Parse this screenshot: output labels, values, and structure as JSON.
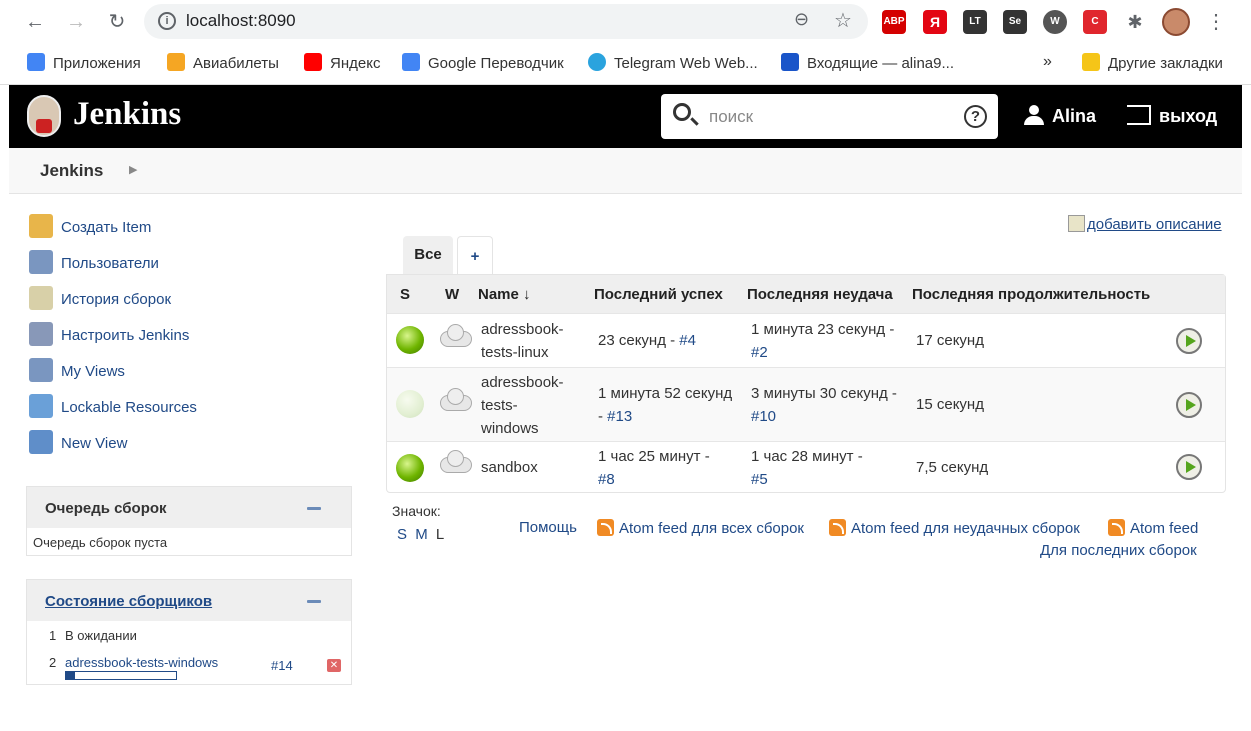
{
  "browser": {
    "url": "localhost:8090",
    "bookmarks": [
      {
        "label": "Приложения",
        "color": "#4285f4"
      },
      {
        "label": "Авиабилеты",
        "color": "#f5a623"
      },
      {
        "label": "Яндекс",
        "color": "#ff0000"
      },
      {
        "label": "Google Переводчик",
        "color": "#4285f4"
      },
      {
        "label": "Telegram Web Web...",
        "color": "#2aa3de"
      },
      {
        "label": "Входящие — alina9...",
        "color": "#1a55c9"
      }
    ],
    "more": "»",
    "other_bookmarks": "Другие закладки",
    "extensions": [
      {
        "label": "ABP",
        "color": "#d40000"
      },
      {
        "label": "Я",
        "color": "#e30613"
      },
      {
        "label": "LT",
        "color": "#333333"
      },
      {
        "label": "Se",
        "color": "#333333"
      },
      {
        "label": "W",
        "color": "#555555"
      },
      {
        "label": "C",
        "color": "#e0262d"
      }
    ]
  },
  "jenkins": {
    "title": "Jenkins",
    "search_placeholder": "поиск",
    "help": "?",
    "user": "Alina",
    "logout": "выход",
    "breadcrumb": "Jenkins"
  },
  "tasks": [
    {
      "label": "Создать Item",
      "icon": "folder-new-icon",
      "color": "#e8b54a"
    },
    {
      "label": "Пользователи",
      "icon": "users-icon",
      "color": "#7a96c0"
    },
    {
      "label": "История сборок",
      "icon": "notepad-icon",
      "color": "#d8d0a8"
    },
    {
      "label": "Настроить Jenkins",
      "icon": "gear-icon",
      "color": "#8898b8"
    },
    {
      "label": "My Views",
      "icon": "users-icon",
      "color": "#7a96c0"
    },
    {
      "label": "Lockable Resources",
      "icon": "usb-icon",
      "color": "#6aa0d8"
    },
    {
      "label": "New View",
      "icon": "folder-icon",
      "color": "#5f8ec9"
    }
  ],
  "queue": {
    "title": "Очередь сборок",
    "empty": "Очередь сборок пуста"
  },
  "executors": {
    "title": "Состояние сборщиков",
    "rows": [
      {
        "num": "1",
        "label": "В ожидании"
      },
      {
        "num": "2",
        "label": "adressbook-tests-windows",
        "build": "#14",
        "progress": 0.08
      }
    ]
  },
  "main": {
    "add_description": "добавить описание",
    "tabs": [
      {
        "label": "Все"
      },
      {
        "label": "+"
      }
    ],
    "columns": {
      "s": "S",
      "w": "W",
      "name": "Name",
      "sort": "↓",
      "last_success": "Последний успех",
      "last_failure": "Последняя неудача",
      "last_duration": "Последняя продолжительность"
    },
    "jobs": [
      {
        "status": "success",
        "weather": "cloudy",
        "name_lines": [
          "adressbook-",
          "tests-linux"
        ],
        "success_text": "23 секунд - ",
        "success_build": "#4",
        "failure_text": "1 минута 23 секунд -",
        "failure_build": "#2",
        "duration": "17 секунд"
      },
      {
        "status": "pending",
        "weather": "cloudy",
        "name_lines": [
          "adressbook-",
          "tests-",
          "windows"
        ],
        "success_text": "1 минута 52 секунд",
        "success_text2": "- ",
        "success_build": "#13",
        "failure_text": "3 минуты 30 секунд -",
        "failure_build": "#10",
        "duration": "15 секунд"
      },
      {
        "status": "success",
        "weather": "cloudy",
        "name_lines": [
          "sandbox"
        ],
        "success_text": "1 час 25 минут -",
        "success_build": "#8",
        "failure_text": "1 час 28 минут -",
        "failure_build": "#5",
        "duration": "7,5 секунд"
      }
    ],
    "icon_label": "Значок:",
    "icon_sizes": [
      "S",
      "M",
      "L"
    ],
    "help": "Помощь",
    "feeds": {
      "all": "Atom feed для всех сборок",
      "failed": "Atom feed для неудачных сборок",
      "latest1": "Atom feed",
      "latest2": "Для последних сборок"
    }
  }
}
